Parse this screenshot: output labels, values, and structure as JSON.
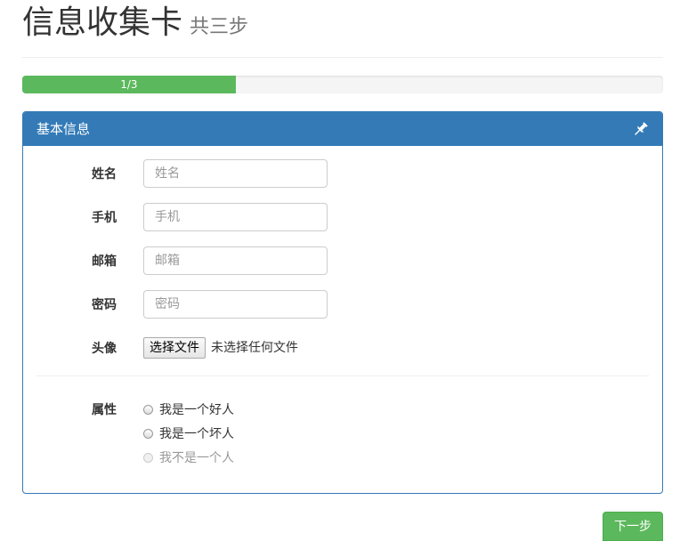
{
  "header": {
    "title": "信息收集卡",
    "subtitle": "共三步"
  },
  "progress": {
    "label": "1/3",
    "fraction": 0.333,
    "color": "#5cb85c"
  },
  "panel": {
    "title": "基本信息",
    "icon": "pin-icon",
    "color": "#337ab7",
    "fields": {
      "name": {
        "label": "姓名",
        "placeholder": "姓名",
        "value": ""
      },
      "phone": {
        "label": "手机",
        "placeholder": "手机",
        "value": ""
      },
      "email": {
        "label": "邮箱",
        "placeholder": "邮箱",
        "value": ""
      },
      "password": {
        "label": "密码",
        "placeholder": "密码",
        "value": ""
      },
      "avatar": {
        "label": "头像",
        "button": "选择文件",
        "status": "未选择任何文件"
      }
    },
    "attribute": {
      "label": "属性",
      "options": [
        {
          "text": "我是一个好人",
          "disabled": false
        },
        {
          "text": "我是一个坏人",
          "disabled": false
        },
        {
          "text": "我不是一个人",
          "disabled": true
        }
      ]
    }
  },
  "actions": {
    "next": "下一步"
  }
}
